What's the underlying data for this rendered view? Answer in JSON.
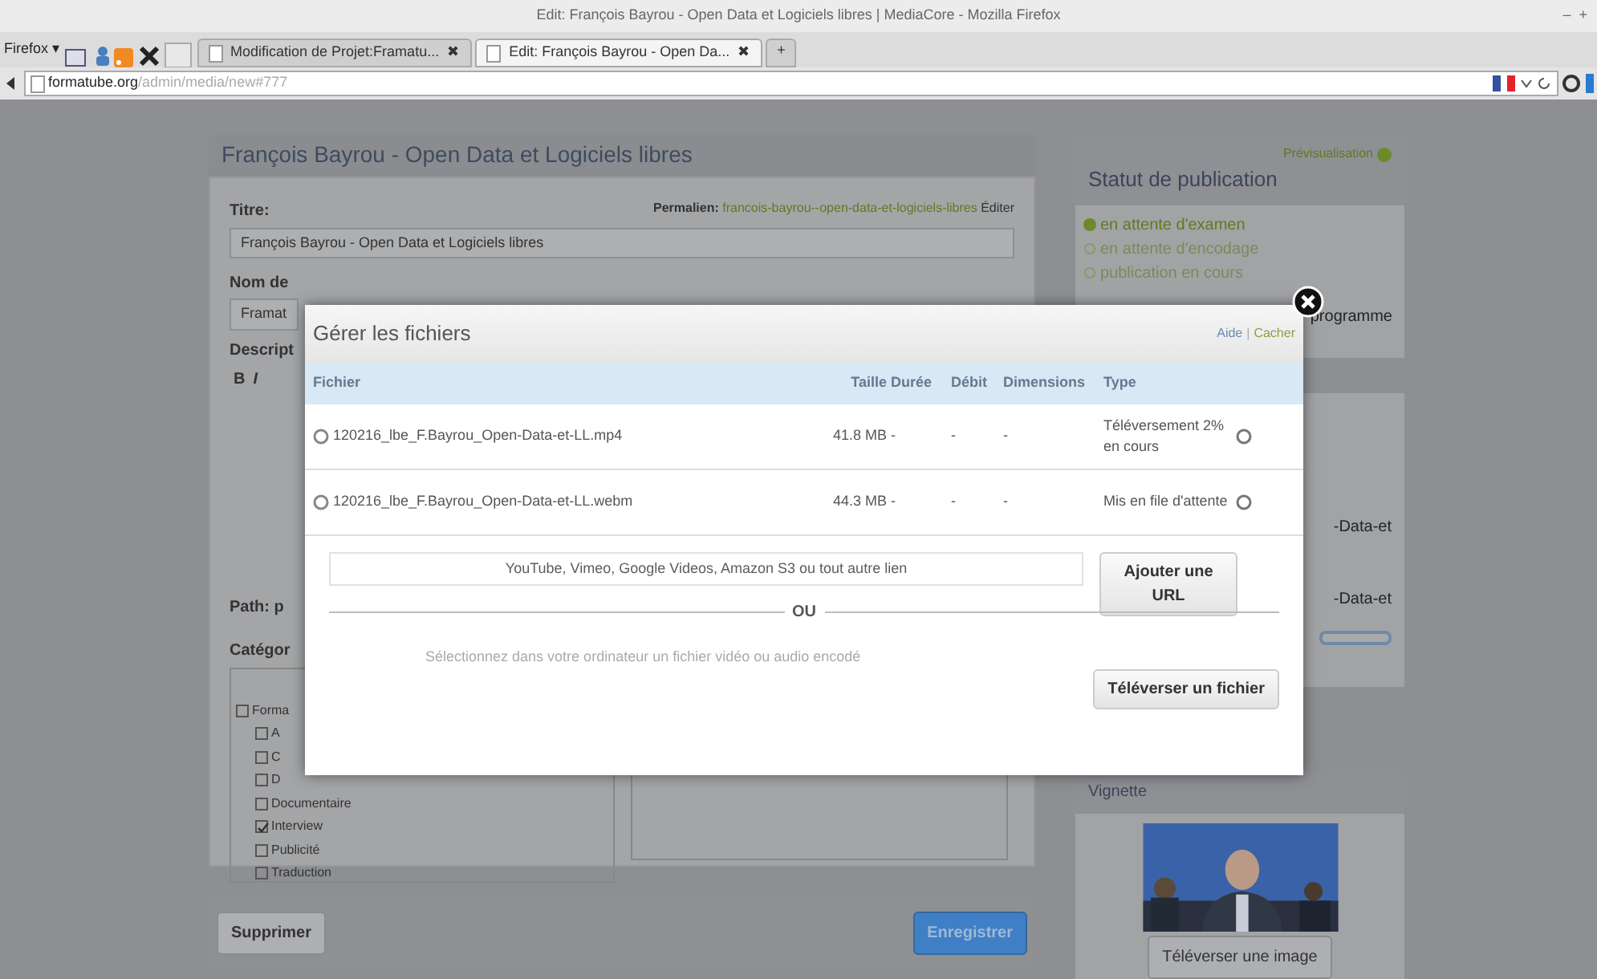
{
  "browser": {
    "window_title": "Edit: François Bayrou - Open Data et Logiciels libres | MediaCore - Mozilla Firefox",
    "window_controls": [
      "–",
      "+"
    ],
    "menu_button": "Firefox ▾",
    "tabs": [
      {
        "label": "Modification de Projet:Framatu...",
        "close": "✖",
        "selected": false
      },
      {
        "label": "Edit: François Bayrou - Open Da...",
        "close": "✖",
        "selected": true
      }
    ],
    "new_tab": "+",
    "url_host": "formatube.org",
    "url_path": "/admin/media/new#777"
  },
  "editor": {
    "heading": "François Bayrou - Open Data et Logiciels libres",
    "title_label": "Titre:",
    "permalink_label": "Permalien:",
    "permalink": "francois-bayrou--open-data-et-logiciels-libres",
    "permalink_edit": "Éditer",
    "title_value": "François Bayrou - Open Data et Logiciels libres",
    "name_label": "Nom de",
    "name_value": "Framat",
    "description_label": "Descript",
    "toolbar": [
      "B",
      "I"
    ],
    "path": "Path: p",
    "categories_label": "Catégor",
    "categories": [
      {
        "label": "Forma",
        "checked": false,
        "children": [
          {
            "label": "A",
            "checked": false
          },
          {
            "label": "C",
            "checked": false
          },
          {
            "label": "D",
            "checked": false
          },
          {
            "label": "Documentaire",
            "checked": false
          },
          {
            "label": "Interview",
            "checked": true
          },
          {
            "label": "Publicité",
            "checked": false
          },
          {
            "label": "Traduction",
            "checked": false
          }
        ]
      }
    ],
    "delete_button": "Supprimer",
    "save_button": "Enregistrer"
  },
  "sidebar": {
    "preview": "Prévisualisation",
    "status_title": "Statut de publication",
    "statuses": [
      {
        "label": "en attente d'examen",
        "selected": true
      },
      {
        "label": "en attente d'encodage",
        "selected": false
      },
      {
        "label": "publication en cours",
        "selected": false
      }
    ],
    "status_note": "programme",
    "files": [
      "-Data-et",
      "-Data-et"
    ],
    "thumbnail_title": "Vignette",
    "thumbnail": {
      "kind": "picture"
    },
    "upload_image_button": "Téléverser une image"
  },
  "modal": {
    "title": "Gérer les fichiers",
    "help": "Aide",
    "separator": "|",
    "hide": "Cacher",
    "columns": [
      "Fichier",
      "Taille",
      "Durée",
      "Débit",
      "Dimensions",
      "Type"
    ],
    "rows": [
      {
        "file": "120216_lbe_F.Bayrou_Open-Data-et-LL.mp4",
        "size": "41.8 MB",
        "duration": "-",
        "bitrate": "-",
        "dimensions": "-",
        "type": "Téléversement 2% en cours"
      },
      {
        "file": "120216_lbe_F.Bayrou_Open-Data-et-LL.webm",
        "size": "44.3 MB",
        "duration": "-",
        "bitrate": "-",
        "dimensions": "-",
        "type": "Mis en file d'attente"
      }
    ],
    "url_placeholder": "YouTube, Vimeo, Google Videos, Amazon S3 ou tout autre lien",
    "add_url_button": "Ajouter une URL",
    "or": "OU",
    "upload_hint": "Sélectionnez dans votre ordinateur un fichier vidéo ou audio encodé",
    "upload_button": "Téléverser un fichier"
  }
}
